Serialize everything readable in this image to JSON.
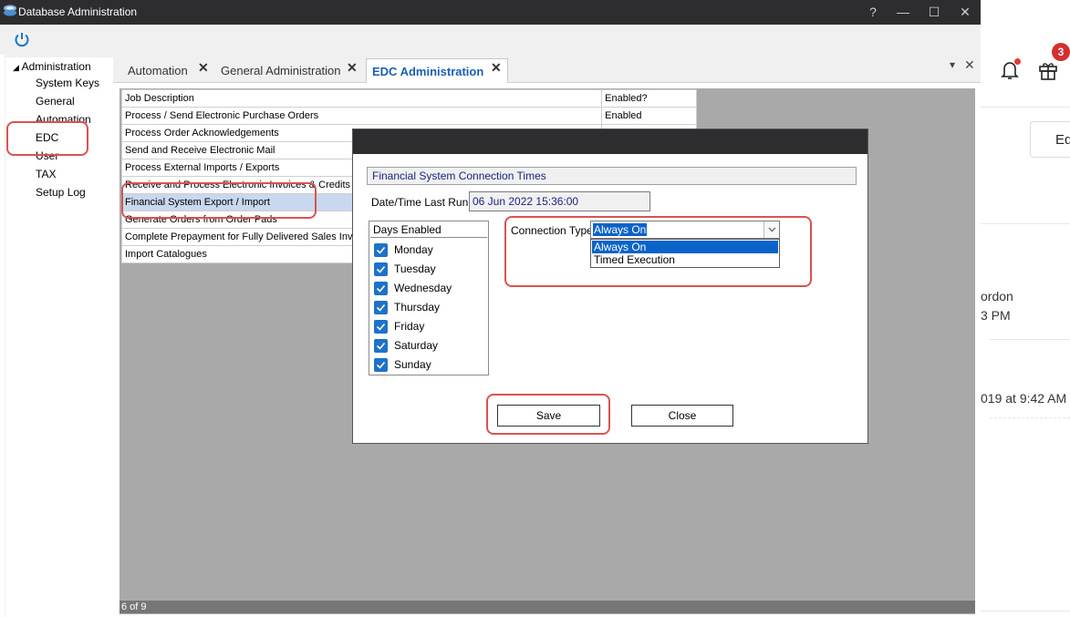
{
  "window": {
    "title": "Database Administration",
    "controls": {
      "help": "?",
      "minimize": "—",
      "maximize": "☐",
      "close": "✕"
    }
  },
  "tree": {
    "root": "Administration",
    "items": [
      "System Keys",
      "General",
      "Automation",
      "EDC",
      "User",
      "TAX",
      "Setup Log"
    ]
  },
  "tabs": [
    {
      "label": "Automation",
      "close": "✕"
    },
    {
      "label": "General Administration",
      "close": "✕"
    },
    {
      "label": "EDC Administration",
      "close": "✕"
    }
  ],
  "tab_controls": {
    "menu": "▾",
    "close": "✕"
  },
  "grid": {
    "headers": [
      "Job Description",
      "Enabled?"
    ],
    "rows": [
      [
        "Process / Send Electronic Purchase Orders",
        "Enabled"
      ],
      [
        "Process Order Acknowledgements",
        ""
      ],
      [
        "Send and Receive Electronic Mail",
        ""
      ],
      [
        "Process External Imports / Exports",
        ""
      ],
      [
        "Receive and Process Electronic Invoices & Credits",
        ""
      ],
      [
        "Financial System Export / Import",
        ""
      ],
      [
        "Generate Orders from Order Pads",
        ""
      ],
      [
        "Complete Prepayment for Fully Delivered Sales Invoices",
        ""
      ],
      [
        "Import Catalogues",
        ""
      ]
    ],
    "footer": "6 of 9"
  },
  "dialog": {
    "header": "Financial System Connection Times",
    "last_run_label": "Date/Time Last Run",
    "last_run_value": "06 Jun 2022 15:36:00",
    "days_title": "Days Enabled",
    "days": [
      "Monday",
      "Tuesday",
      "Wednesday",
      "Thursday",
      "Friday",
      "Saturday",
      "Sunday"
    ],
    "connection_label": "Connection Type",
    "connection_value": "Always On",
    "connection_options": [
      "Always On",
      "Timed Execution"
    ],
    "save_label": "Save",
    "close_label": "Close"
  },
  "background_app": {
    "notification_count": "3",
    "edit_label": "Ed",
    "line1": "ordon",
    "line2": "3 PM",
    "line3": "019 at 9:42 AM"
  },
  "colors": {
    "accent": "#1e72c8",
    "annotation": "#d9534f",
    "selection": "#0a63c9"
  }
}
